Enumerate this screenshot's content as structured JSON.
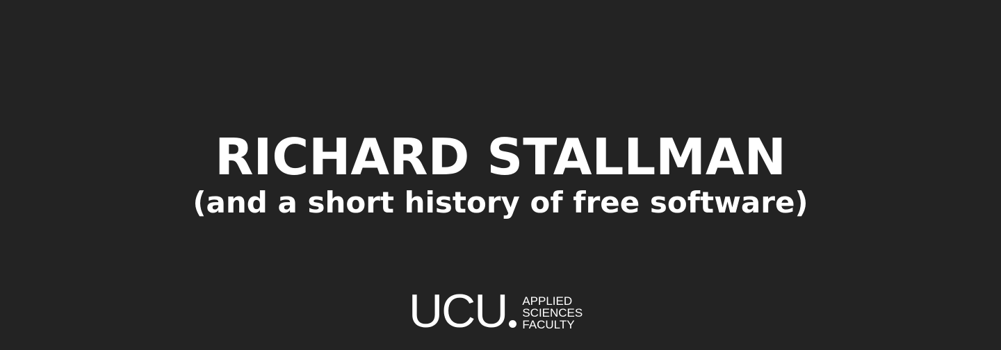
{
  "slide": {
    "title": "RICHARD STALLMAN",
    "subtitle": "(and a short history of free software)"
  },
  "logo": {
    "mark": "UCU",
    "text_lines": [
      "APPLIED",
      "SCIENCES",
      "FACULTY"
    ]
  },
  "colors": {
    "background": "#232323",
    "text": "#ffffff"
  }
}
